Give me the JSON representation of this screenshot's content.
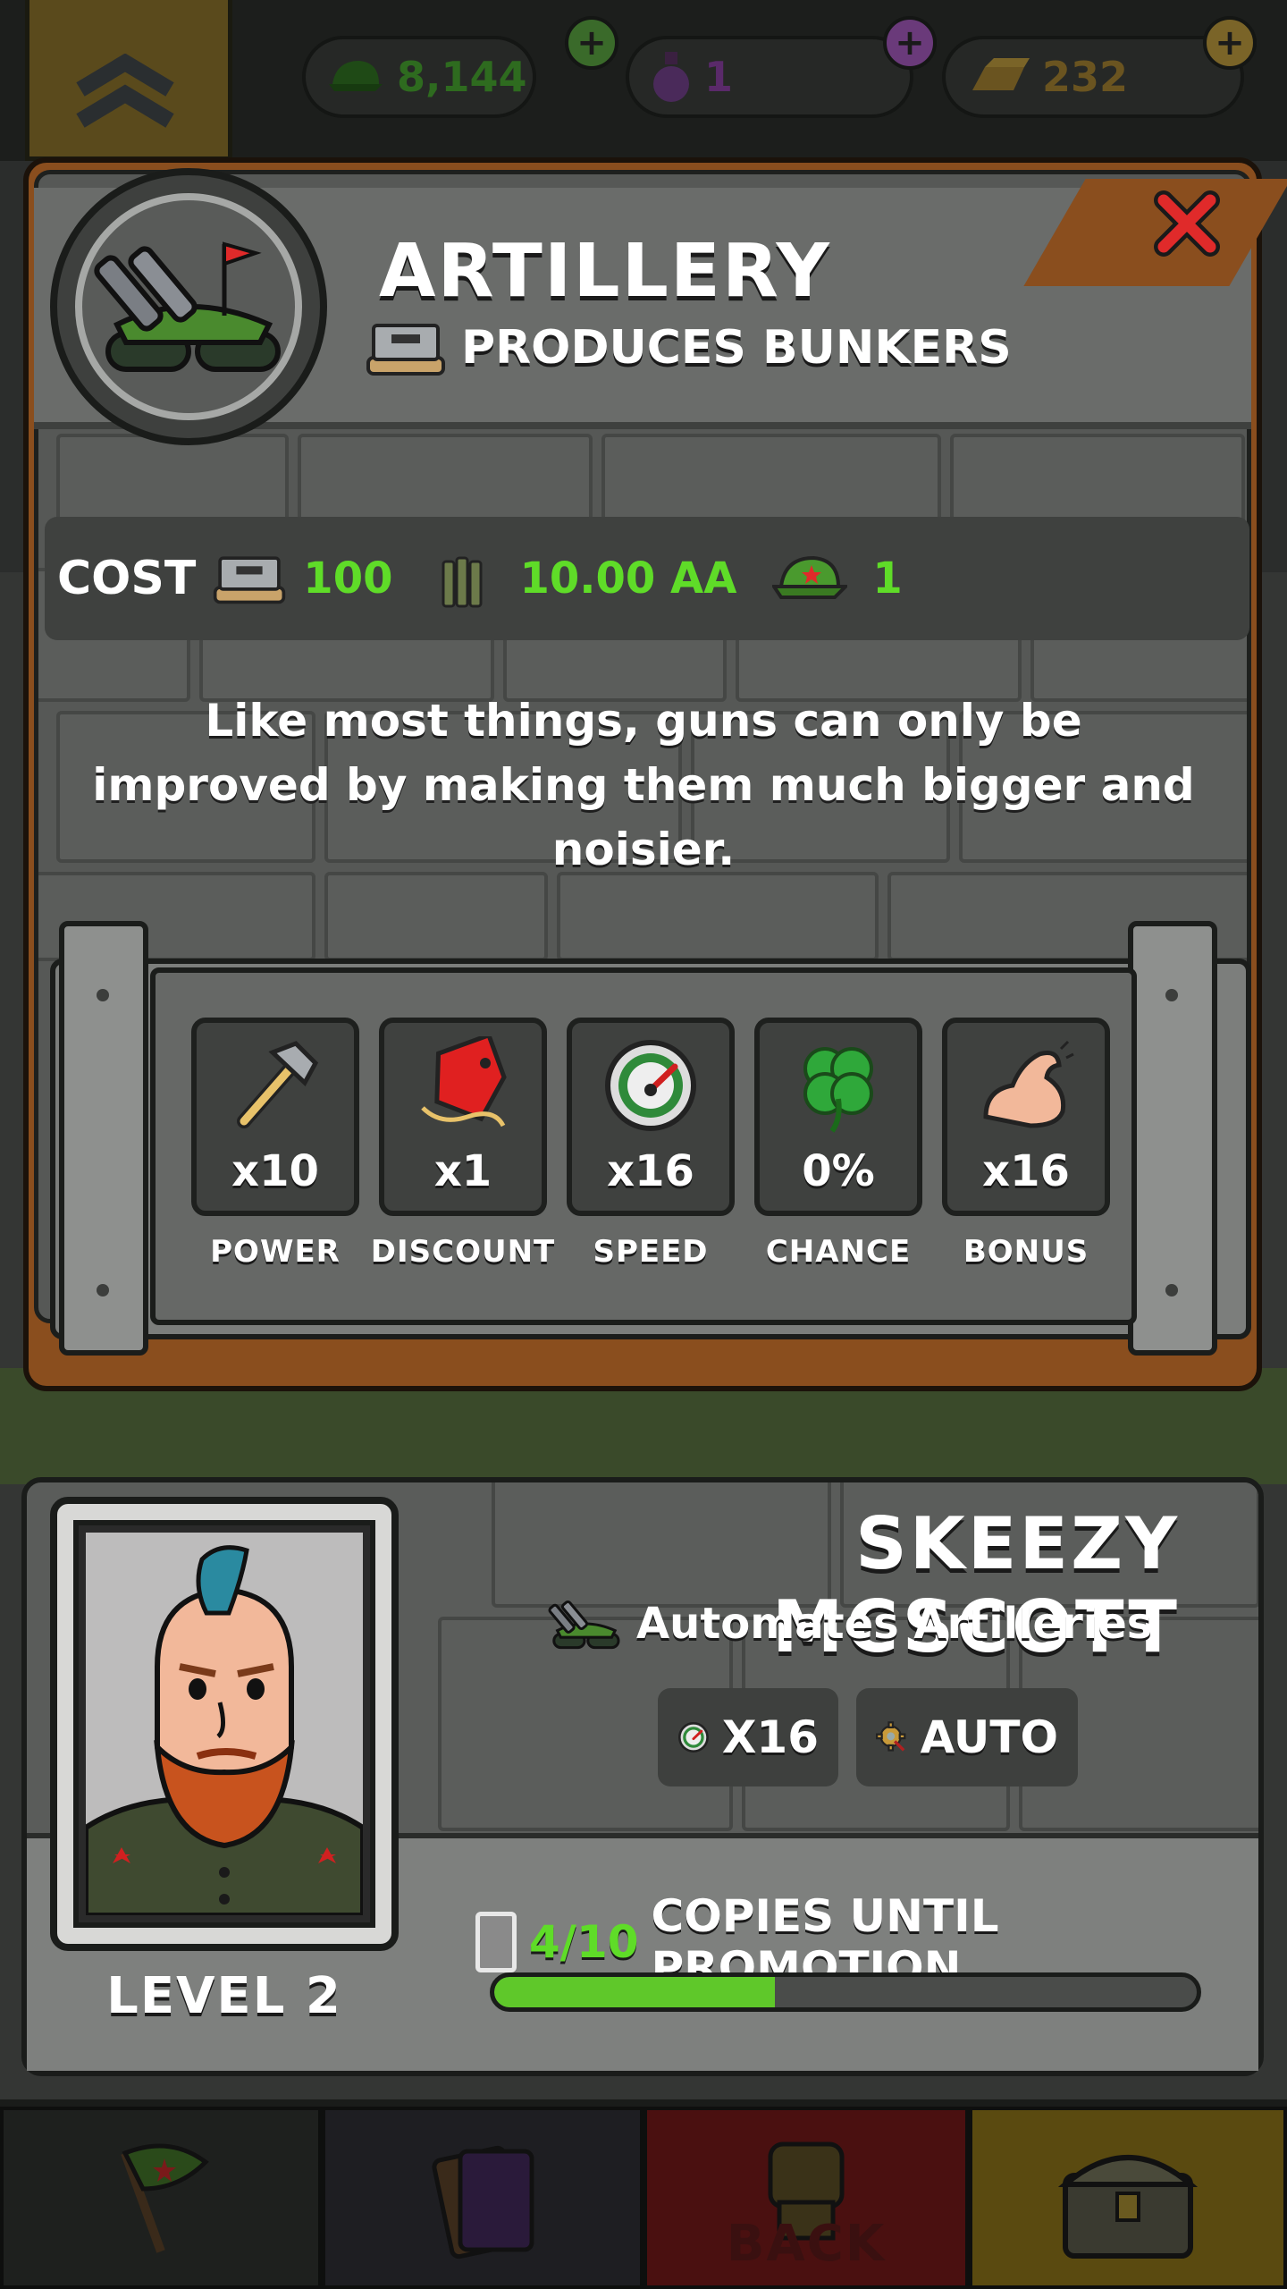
{
  "colors": {
    "accent_green": "#5fdc28",
    "wood": "#8a4e1e",
    "stone": "#565856",
    "close_red": "#e02a2a"
  },
  "top_bar": {
    "rank_icon": "sergeant-chevron-icon",
    "resources": [
      {
        "icon": "cap-icon",
        "value": "8,144",
        "color": "#2e6b1f"
      },
      {
        "icon": "potion-icon",
        "value": "1",
        "color": "#5a2a6a"
      },
      {
        "icon": "gold-bars-icon",
        "value": "232",
        "color": "#6a5420"
      }
    ]
  },
  "dialog": {
    "icon": "artillery-tank-icon",
    "title": "ARTILLERY",
    "subtitle_icon": "bunker-icon",
    "subtitle": "PRODUCES BUNKERS",
    "close_icon": "close-x-icon",
    "cost": {
      "label": "COST",
      "items": [
        {
          "icon": "bunker-icon",
          "value": "100"
        },
        {
          "icon": "ammo-icon",
          "value": "10.00 AA"
        },
        {
          "icon": "cap-icon",
          "value": "1"
        }
      ]
    },
    "description": "Like most things, guns can only be improved by making them much bigger and noisier.",
    "stats": [
      {
        "icon": "hammer-icon",
        "value": "x10",
        "label": "POWER"
      },
      {
        "icon": "price-tag-icon",
        "value": "x1",
        "label": "DISCOUNT"
      },
      {
        "icon": "speedometer-icon",
        "value": "x16",
        "label": "SPEED"
      },
      {
        "icon": "clover-icon",
        "value": "0%",
        "label": "CHANCE"
      },
      {
        "icon": "bicep-icon",
        "value": "x16",
        "label": "BONUS"
      }
    ]
  },
  "manager": {
    "portrait": "manager-portrait",
    "name": "SKEEZY MCSCOTT",
    "desc_icon": "artillery-tank-icon",
    "description": "Automates Artilleries",
    "badges": [
      {
        "icon": "speedometer-icon",
        "text": "X16"
      },
      {
        "icon": "gear-auto-icon",
        "text": "AUTO"
      }
    ],
    "level": "LEVEL 2",
    "promotion": {
      "count": "4/10",
      "text": "COPIES UNTIL PROMOTION",
      "progress": 0.4
    }
  },
  "bottom_nav": {
    "back_label": "BACK"
  }
}
